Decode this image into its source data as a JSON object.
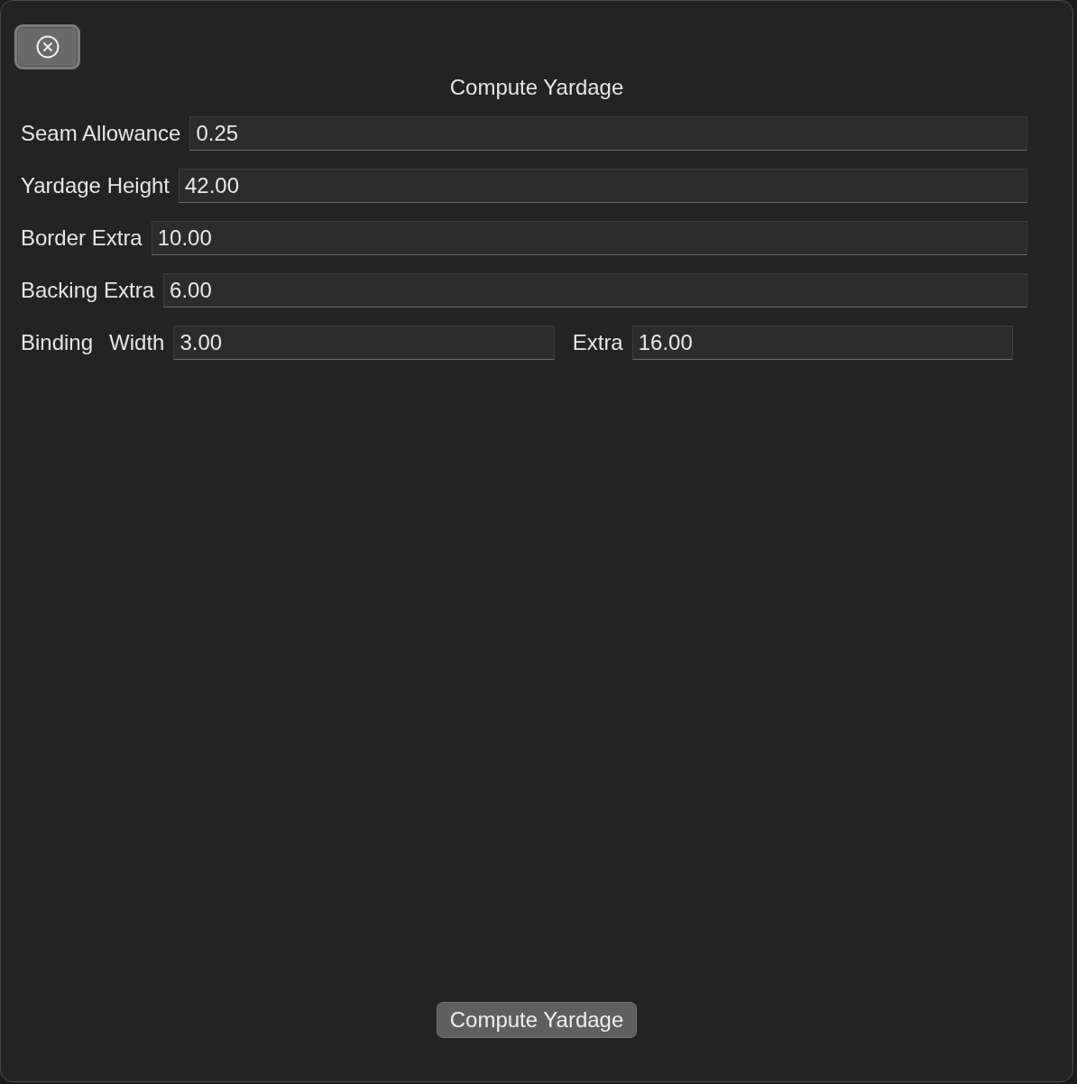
{
  "window": {
    "title": "Compute Yardage"
  },
  "rows": [
    {
      "kind": "single",
      "label": "Seam Allowance",
      "value": "0.25"
    },
    {
      "kind": "single",
      "label": "Yardage Height",
      "value": "42.00"
    },
    {
      "kind": "single",
      "label": "Border Extra",
      "value": "10.00"
    },
    {
      "kind": "single",
      "label": "Backing Extra",
      "value": "6.00"
    },
    {
      "kind": "pair",
      "label": "Binding",
      "fields": [
        {
          "label": "Width",
          "value": "3.00"
        },
        {
          "label": "Extra",
          "value": "16.00"
        }
      ]
    }
  ],
  "button": {
    "label": "Compute Yardage"
  }
}
